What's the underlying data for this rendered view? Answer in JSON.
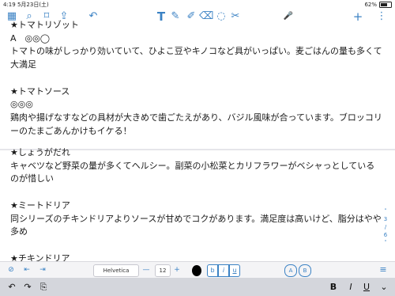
{
  "status": {
    "time": "4:19",
    "date": "5月23日(土)",
    "battery": "62%"
  },
  "toolbar": {
    "grid_icon": "▦",
    "search_icon": "⌕",
    "bookmark_icon": "⌑",
    "share_icon": "⇪",
    "undo_icon": "↶",
    "text_tool": "T",
    "pen_icon": "✎",
    "highlighter_icon": "✐",
    "eraser_icon": "⌫",
    "lasso_icon": "◌",
    "scissors_icon": "✂",
    "mic_icon": "🎤",
    "add_icon": "+",
    "more_icon": "⋮"
  },
  "page1": {
    "text": "★トマトリゾット\nA　◎◎◯\nトマトの味がしっかり効いていて、ひよこ豆やキノコなど具がいっぱい。麦ごはんの量も多くて大満足\n\n★トマトソース\n◎◎◎\n鶏肉や揚げなすなどの具材が大きめで歯ごたえがあり、バジル風味が合っています。ブロッコリーのたまごあんかけもイケる！"
  },
  "page2": {
    "text": "★しょうがだれ\nキャベツなど野菜の量が多くてヘルシー。副菜の小松菜とカリフラワーがベシャっとしているのが惜しい\n\n★ミートドリア\n同シリーズのチキンドリアよりソースが甘めでコクがあります。満足度は高いけど、脂分はやや多め\n\n★チキンドリア\nチキンは小さめだけど、ソースの味がしっかりしており、麦のプチプチ感もあります。塩分も控えめ"
  },
  "pager": {
    "up": "˄",
    "current": "3",
    "divider": "/",
    "total": "6",
    "down": "˅"
  },
  "formatbar": {
    "check_icon": "⊘",
    "prev_icon": "⇤",
    "next_icon": "⇥",
    "font": "Helvetica Neue",
    "minus": "—",
    "size": "12",
    "plus": "+",
    "bold": "b",
    "italic": "i",
    "underline": "u",
    "a_icon": "A",
    "b_icon": "B",
    "list_icon": "≡"
  },
  "keybar": {
    "undo": "↶",
    "redo": "↷",
    "paste": "⎘",
    "bold": "B",
    "italic": "I",
    "underline": "U",
    "menu": "⌄"
  }
}
